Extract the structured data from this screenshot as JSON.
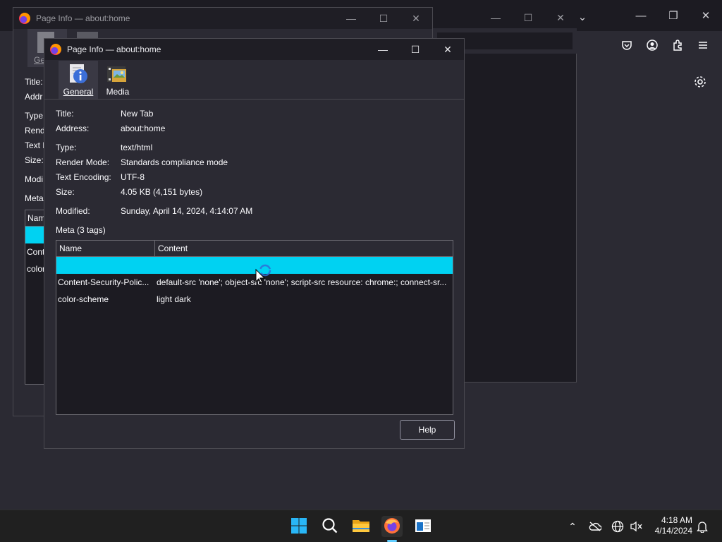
{
  "back_dialog": {
    "title": "Page Info — about:home",
    "tab_general": "Ge",
    "rows": [
      "Title:",
      "Addr",
      "Type:",
      "Rend",
      "Text E",
      "Size:",
      "Modi",
      "Meta"
    ],
    "table_head": "Nam",
    "table_rows": [
      "Cont",
      "color"
    ]
  },
  "dialog": {
    "title": "Page Info — about:home",
    "tabs": [
      "General",
      "Media"
    ],
    "fields": {
      "title_label": "Title:",
      "title_value": "New Tab",
      "address_label": "Address:",
      "address_value": "about:home",
      "type_label": "Type:",
      "type_value": "text/html",
      "render_label": "Render Mode:",
      "render_value": "Standards compliance mode",
      "encoding_label": "Text Encoding:",
      "encoding_value": "UTF-8",
      "size_label": "Size:",
      "size_value": "4.05 KB (4,151 bytes)",
      "modified_label": "Modified:",
      "modified_value": "Sunday, April 14, 2024, 4:14:07 AM"
    },
    "meta_heading": "Meta (3 tags)",
    "meta_columns": [
      "Name",
      "Content"
    ],
    "meta_rows": [
      {
        "name": "",
        "content": ""
      },
      {
        "name": "Content-Security-Polic...",
        "content": "default-src 'none'; object-src 'none'; script-src resource: chrome:; connect-sr..."
      },
      {
        "name": "color-scheme",
        "content": "light dark"
      }
    ],
    "help_label": "Help"
  },
  "taskbar": {
    "time": "4:18 AM",
    "date": "4/14/2024"
  },
  "colors": {
    "selection": "#00d2f2",
    "accent": "#00ddff"
  }
}
